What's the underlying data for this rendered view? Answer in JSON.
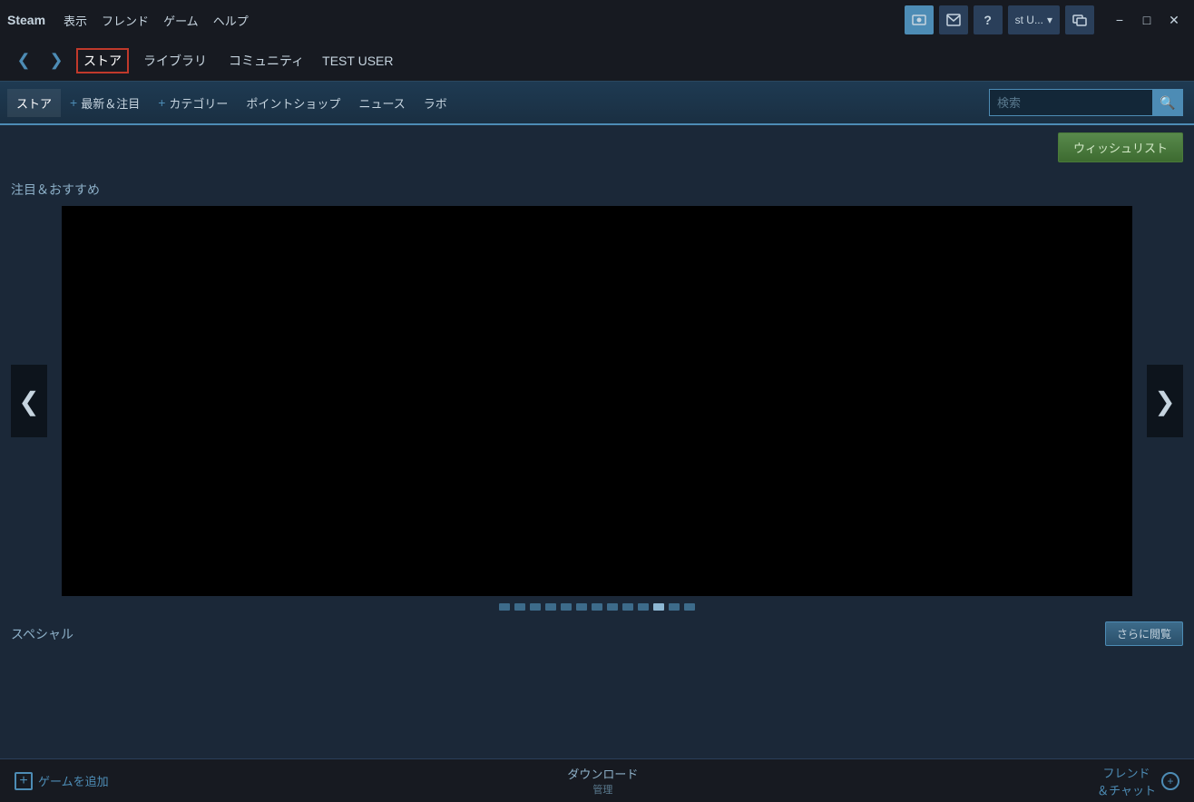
{
  "titlebar": {
    "steam_label": "Steam",
    "menu_items": [
      "表示",
      "フレンド",
      "ゲーム",
      "ヘルプ"
    ],
    "user_label": "st U...",
    "icons": {
      "camera": "📷",
      "mail": "✉",
      "help": "?",
      "screenshot": "🖼"
    }
  },
  "navbar": {
    "back_arrow": "❮",
    "forward_arrow": "❯",
    "tabs": [
      {
        "label": "ストア",
        "active": true
      },
      {
        "label": "ライブラリ",
        "active": false
      },
      {
        "label": "コミュニティ",
        "active": false
      }
    ],
    "username": "TEST USER"
  },
  "subnav": {
    "items": [
      {
        "label": "ストア",
        "active": true,
        "prefix": ""
      },
      {
        "label": "最新＆注目",
        "active": false,
        "prefix": "+ "
      },
      {
        "label": "カテゴリー",
        "active": false,
        "prefix": "+ "
      },
      {
        "label": "ポイントショップ",
        "active": false,
        "prefix": ""
      },
      {
        "label": "ニュース",
        "active": false,
        "prefix": ""
      },
      {
        "label": "ラボ",
        "active": false,
        "prefix": ""
      }
    ],
    "search_placeholder": "検索"
  },
  "main": {
    "wishlist_label": "ウィッシュリスト",
    "featured_label": "注目＆おすすめ",
    "carousel_dots": [
      0,
      1,
      2,
      3,
      4,
      5,
      6,
      7,
      8,
      9,
      10,
      11,
      12
    ],
    "active_dot": 10,
    "left_arrow": "❮",
    "right_arrow": "❯",
    "special_label": "スペシャル",
    "more_btn_label": "さらに閲覧"
  },
  "statusbar": {
    "add_game_label": "ゲームを追加",
    "download_label": "ダウンロード",
    "download_sub": "管理",
    "friends_label": "フレンド\n＆チャット"
  }
}
